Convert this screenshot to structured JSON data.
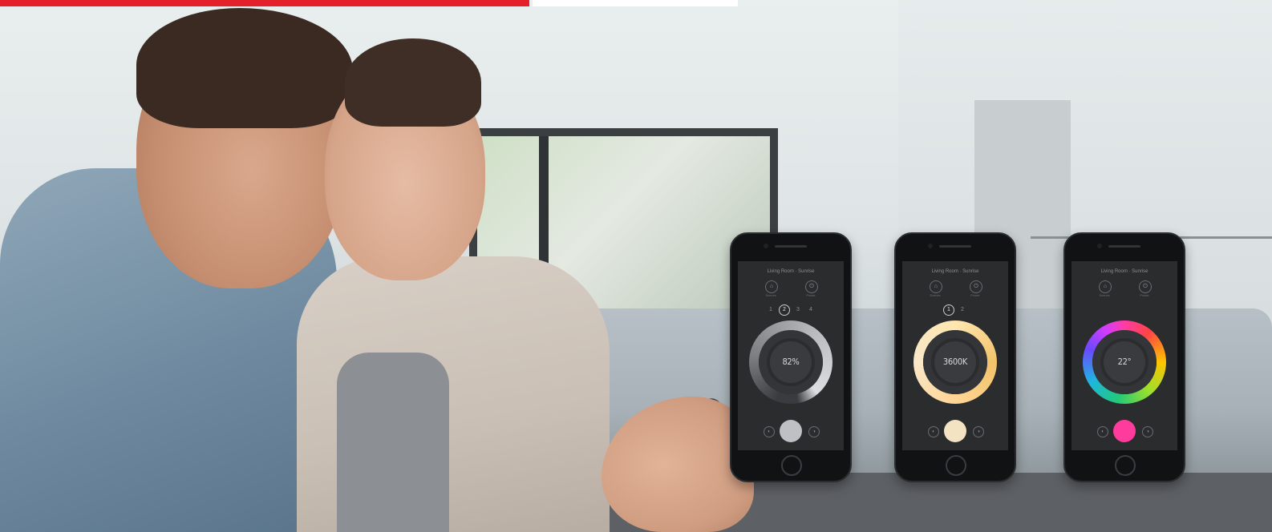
{
  "phones": [
    {
      "header": "Living Room · Sunrise",
      "left_icon_label": "Scenes",
      "right_icon_label": "Power",
      "tabs": [
        "1",
        "2",
        "3",
        "4"
      ],
      "active_tab": "2",
      "ring_value": "82%",
      "sub_label": "",
      "accent": "#bfc0c3"
    },
    {
      "header": "Living Room · Sunrise",
      "left_icon_label": "Scenes",
      "right_icon_label": "Power",
      "tabs": [
        "1",
        "2"
      ],
      "active_tab": "1",
      "ring_value": "3600K",
      "sub_label": "",
      "accent": "#f4e3c2"
    },
    {
      "header": "Living Room · Sunrise",
      "left_icon_label": "Scenes",
      "right_icon_label": "Power",
      "tabs": [],
      "active_tab": "",
      "ring_value": "22°",
      "sub_label": "",
      "accent": "#ff3c9d"
    }
  ],
  "brand_colors": {
    "red": "#e4202a",
    "white": "#ffffff"
  }
}
